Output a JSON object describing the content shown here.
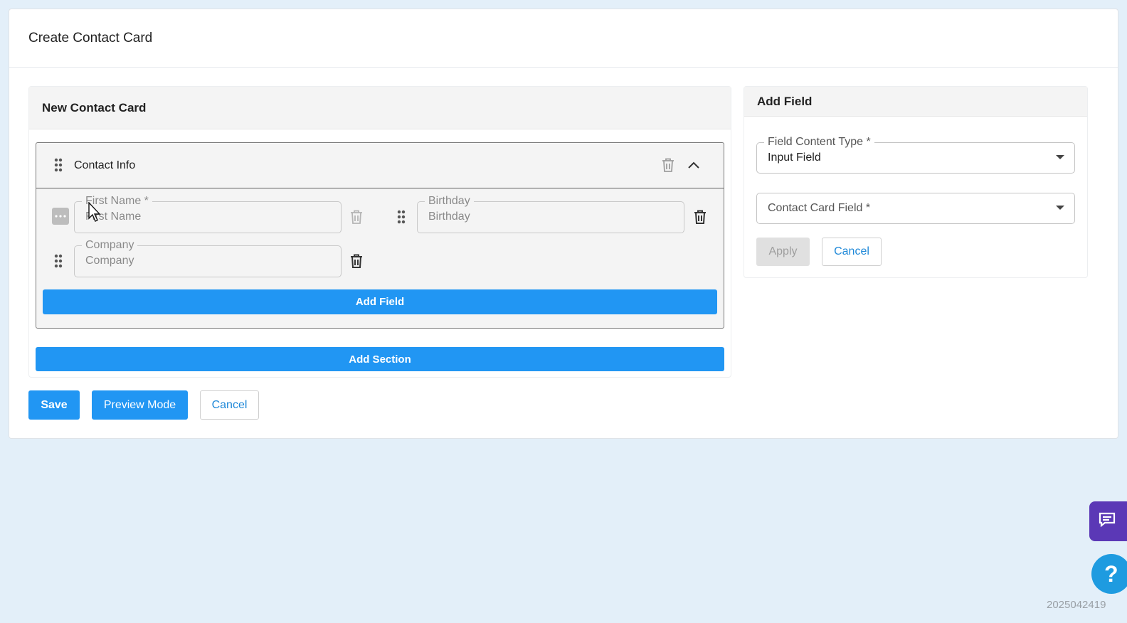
{
  "header": {
    "title": "Create Contact Card"
  },
  "builder": {
    "title": "New Contact Card",
    "section": {
      "title": "Contact Info",
      "fields": [
        {
          "label": "First Name *",
          "placeholder": "First Name"
        },
        {
          "label": "Birthday",
          "placeholder": "Birthday"
        },
        {
          "label": "Company",
          "placeholder": "Company"
        }
      ],
      "add_field_label": "Add Field"
    },
    "add_section_label": "Add Section"
  },
  "actions": {
    "save": "Save",
    "preview": "Preview Mode",
    "cancel": "Cancel"
  },
  "add_field_panel": {
    "title": "Add Field",
    "content_type_label": "Field Content Type *",
    "content_type_value": "Input Field",
    "card_field_placeholder": "Contact Card Field *",
    "apply_label": "Apply",
    "cancel_label": "Cancel"
  },
  "widgets": {
    "help_glyph": "?",
    "build_id": "2025042419"
  },
  "colors": {
    "primary": "#2196f3",
    "background": "#e3eff9",
    "chat": "#5b38b6",
    "help": "#1e9be0"
  }
}
